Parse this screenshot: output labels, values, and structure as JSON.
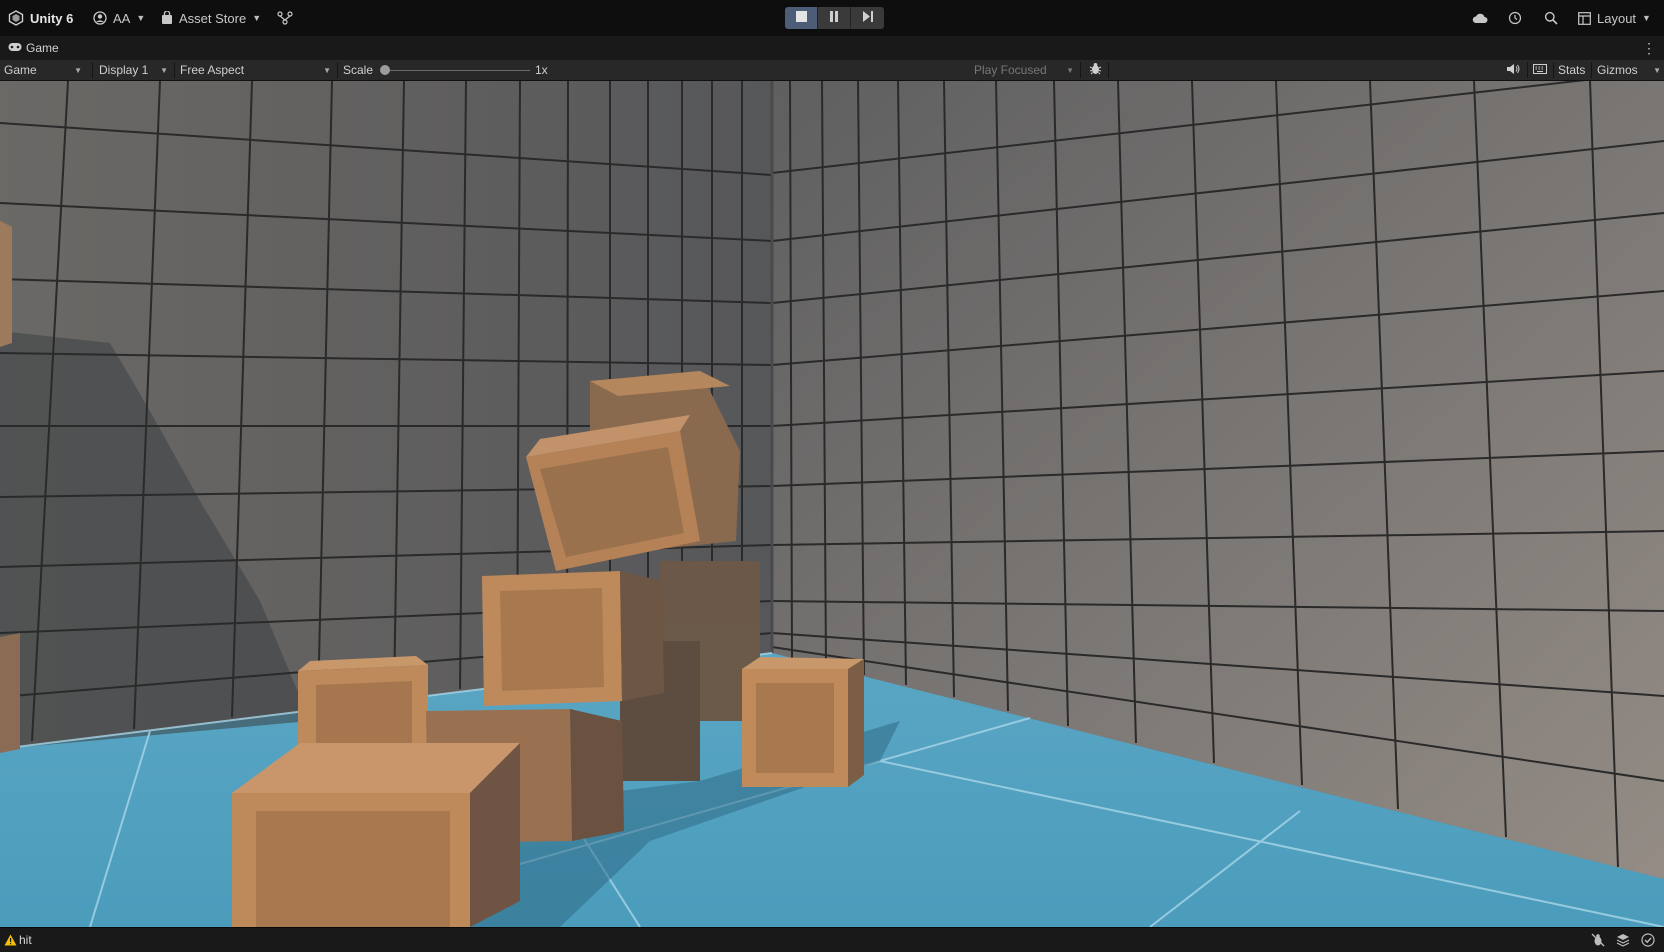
{
  "toolbar": {
    "unity_label": "Unity 6",
    "account_label": "AA",
    "asset_store_label": "Asset Store",
    "layout_label": "Layout",
    "accent_color": "#4d5d78"
  },
  "tab": {
    "label": "Game"
  },
  "game_toolbar": {
    "view_mode": "Game",
    "display": "Display 1",
    "aspect": "Free Aspect",
    "scale_label": "Scale",
    "scale_value": "1x",
    "play_mode": "Play Focused",
    "stats_label": "Stats",
    "gizmos_label": "Gizmos"
  },
  "status": {
    "message": "hit"
  },
  "icons": [
    "unity-logo-icon",
    "account-icon",
    "asset-store-icon",
    "version-control-icon",
    "play-icon",
    "pause-icon",
    "step-icon",
    "cloud-icon",
    "history-icon",
    "search-icon",
    "layout-icon",
    "game-controller-icon",
    "more-icon",
    "bug-icon",
    "audio-icon",
    "keyboard-icon",
    "warning-icon",
    "debug-off-icon",
    "layers-icon",
    "check-circle-icon"
  ]
}
